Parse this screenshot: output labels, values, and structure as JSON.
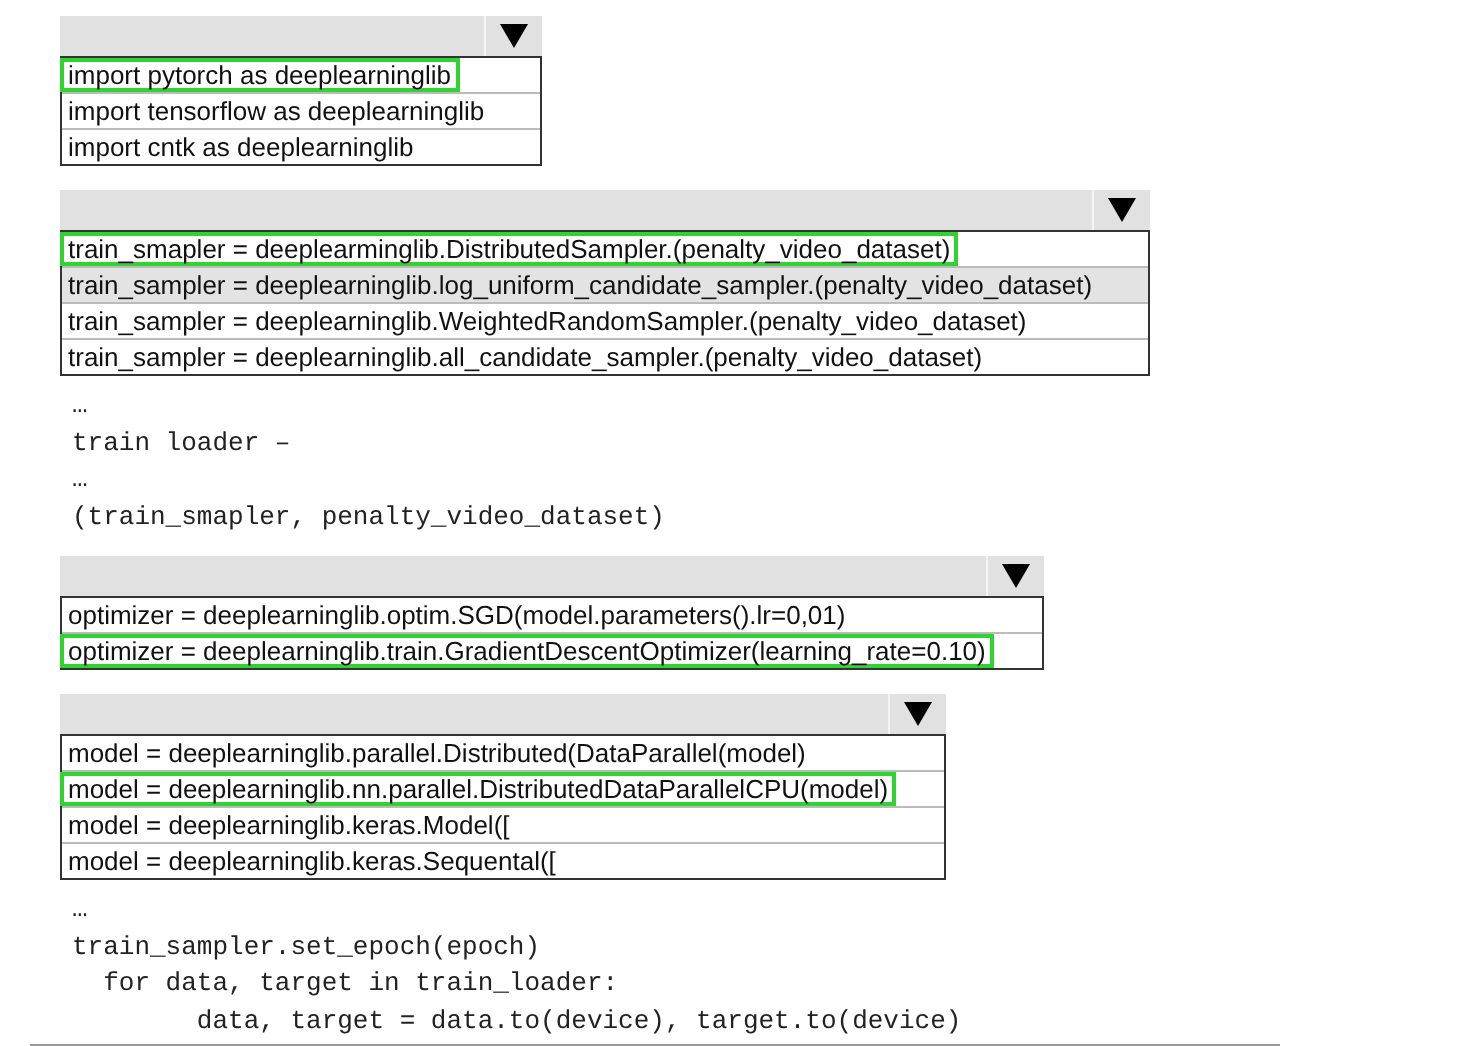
{
  "blocks": [
    {
      "kind": "dropdown",
      "options": [
        {
          "text": "import pytorch as deeplearninglib",
          "selected": true,
          "highlighted": false
        },
        {
          "text": "import tensorflow as deeplearninglib",
          "selected": false,
          "highlighted": false
        },
        {
          "text": "import cntk as deeplearninglib",
          "selected": false,
          "highlighted": false
        }
      ]
    },
    {
      "kind": "dropdown",
      "options": [
        {
          "text": "train_smapler = deeplearminglib.DistributedSampler.(penalty_video_dataset)",
          "selected": true,
          "highlighted": false
        },
        {
          "text": "train_sampler = deeplearninglib.log_uniform_candidate_sampler.(penalty_video_dataset)",
          "selected": false,
          "highlighted": true
        },
        {
          "text": "train_sampler = deeplearninglib.WeightedRandomSampler.(penalty_video_dataset)",
          "selected": false,
          "highlighted": false
        },
        {
          "text": "train_sampler = deeplearninglib.all_candidate_sampler.(penalty_video_dataset)",
          "selected": false,
          "highlighted": false
        }
      ]
    },
    {
      "kind": "code",
      "lines": [
        "…",
        "train loader –",
        "…",
        "(train_smapler, penalty_video_dataset)"
      ]
    },
    {
      "kind": "dropdown",
      "options": [
        {
          "text": "optimizer = deeplearninglib.optim.SGD(model.parameters().lr=0,01)",
          "selected": false,
          "highlighted": false
        },
        {
          "text": "optimizer = deeplearninglib.train.GradientDescentOptimizer(learning_rate=0.10)",
          "selected": true,
          "highlighted": false
        }
      ]
    },
    {
      "kind": "dropdown",
      "options": [
        {
          "text": "model = deeplearninglib.parallel.Distributed(DataParallel(model)",
          "selected": false,
          "highlighted": false
        },
        {
          "text": "model = deeplearninglib.nn.parallel.DistributedDataParallelCPU(model)",
          "selected": true,
          "highlighted": false
        },
        {
          "text": "model = deeplearninglib.keras.Model([",
          "selected": false,
          "highlighted": false
        },
        {
          "text": "model = deeplearninglib.keras.Sequental([",
          "selected": false,
          "highlighted": false
        }
      ]
    },
    {
      "kind": "code",
      "lines": [
        "…",
        "train_sampler.set_epoch(epoch)",
        "  for data, target in train_loader:",
        "        data, target = data.to(device), target.to(device)"
      ]
    }
  ]
}
